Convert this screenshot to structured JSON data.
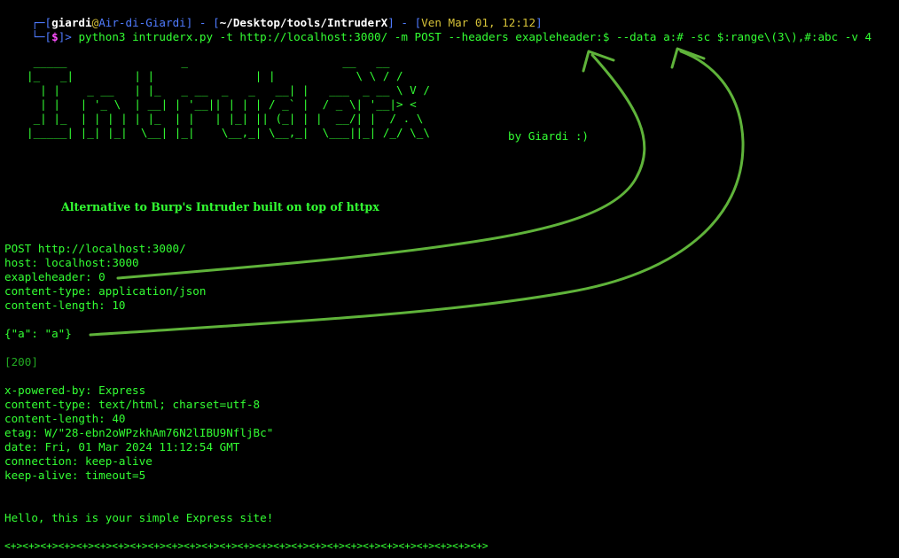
{
  "prompt": {
    "corner1": "┌─[",
    "user": "giardi",
    "at": "@",
    "host": "Air-di-Giardi",
    "sep1": "] - [",
    "path": "~/Desktop/tools/IntruderX",
    "sep2": "] - [",
    "datetime": "Ven Mar 01, 12:12",
    "close": "]",
    "corner2": "└─[",
    "dollar": "$",
    "prompt_end": "]> ",
    "command": "python3 intruderx.py -t http://localhost:3000/ -m POST --headers exapleheader:$ --data a:# -sc $:range\\(3\\),#:abc -v 4"
  },
  "banner": {
    "ascii": " _____                 _                       __   __\n|_   _|         | |               | |            \\ \\ / /\n  | |    _ __   | |_   _ __  _   _   __| |   ___  _ __ \\ V /\n  | |   | '_ \\  | __| | '__|| | | | / _` |  / _ \\| '__|> <\n _| |_  | | | | | |_  | |   | |_| || (_| | |  __/| |  / . \\\n|_____| |_| |_|  \\__| |_|    \\__,_| \\__,_|  \\___||_| /_/ \\_\\",
    "byline": "by Giardi :)",
    "tagline": "Alternative to Burp's Intruder built on top of httpx"
  },
  "request": {
    "line1": "POST http://localhost:3000/",
    "line2": "host: localhost:3000",
    "line3": "exapleheader: 0",
    "line4": "content-type: application/json",
    "line5": "content-length: 10",
    "body": "{\"a\": \"a\"}"
  },
  "response": {
    "status": "[200]",
    "h1": "x-powered-by: Express",
    "h2": "content-type: text/html; charset=utf-8",
    "h3": "content-length: 40",
    "h4": "etag: W/\"28-ebn2oWPzkhAm76N2lIBU9NfljBc\"",
    "h5": "date: Fri, 01 Mar 2024 11:12:54 GMT",
    "h6": "connection: keep-alive",
    "h7": "keep-alive: timeout=5",
    "body": "Hello, this is your simple Express site!",
    "separator": "<+><+><+><+><+><+><+><+><+><+><+><+><+><+><+><+><+><+><+><+><+><+><+><+><+><+><+>"
  },
  "colors": {
    "background": "#000000",
    "text_green": "#33ff33",
    "bracket_blue": "#4f7bff",
    "datetime_yellow": "#d6c238",
    "dollar_magenta": "#ff4fff",
    "annotation_arrow": "#5fb33a"
  }
}
